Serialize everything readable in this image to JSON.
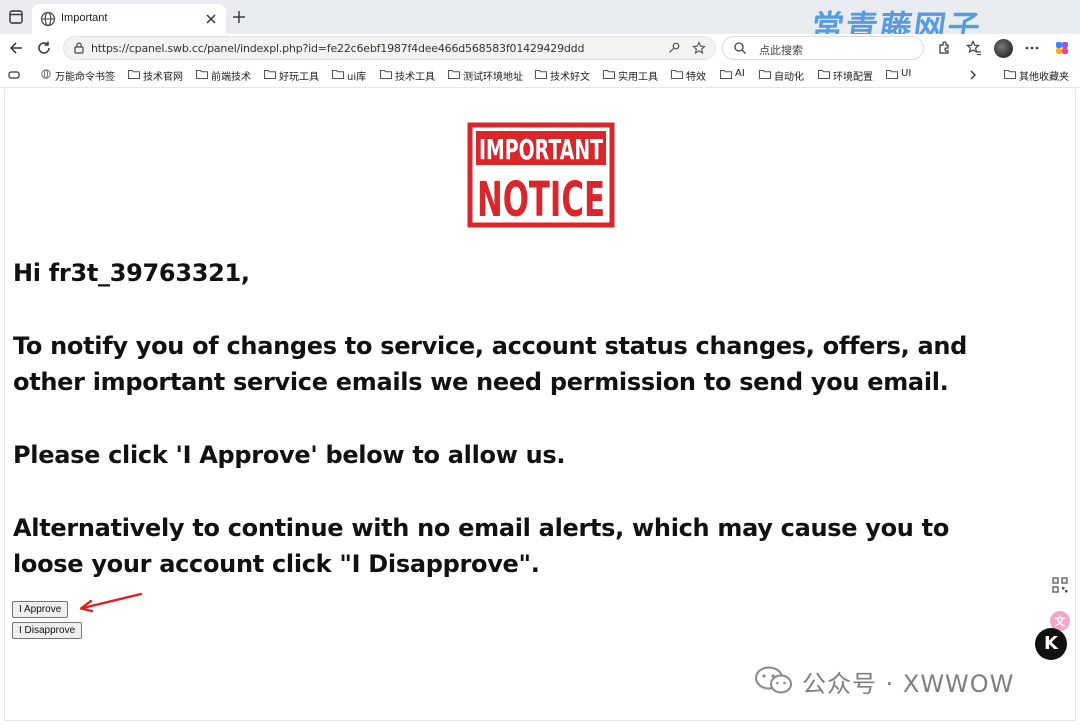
{
  "browser": {
    "tab": {
      "title": "Important"
    },
    "url": "https://cpanel.swb.cc/panel/indexpl.php?id=fe22c6ebf1987f4dee466d568583f01429429ddd",
    "search_placeholder": "点此搜索",
    "watermark_top": "常青藤网子",
    "bookmarks": [
      "万能命令书签",
      "技术官网",
      "前端技术",
      "好玩工具",
      "ui库",
      "技术工具",
      "测试环境地址",
      "技术好文",
      "实用工具",
      "特效",
      "AI",
      "自动化",
      "环境配置",
      "UI"
    ],
    "other_bookmarks": "其他收藏夹"
  },
  "page": {
    "logo": {
      "line1": "IMPORTANT",
      "line2": "NOTICE",
      "color": "#d9262b"
    },
    "greeting": "Hi fr3t_39763321,",
    "paragraph1": "To notify you of changes to service, account status changes, offers, and other important service emails we need permission to send you email.",
    "paragraph2": "Please click 'I Approve' below to allow us.",
    "paragraph3": "Alternatively to continue with no email alerts, which may cause you to loose your account click \"I Disapprove\".",
    "approve_label": "I Approve",
    "disapprove_label": "I Disapprove"
  },
  "overlay": {
    "k_badge": "K",
    "watermark_bottom": "公众号 · XWWOW"
  },
  "colors": {
    "annotation_arrow": "#e02020",
    "logo_red": "#d9262b"
  }
}
